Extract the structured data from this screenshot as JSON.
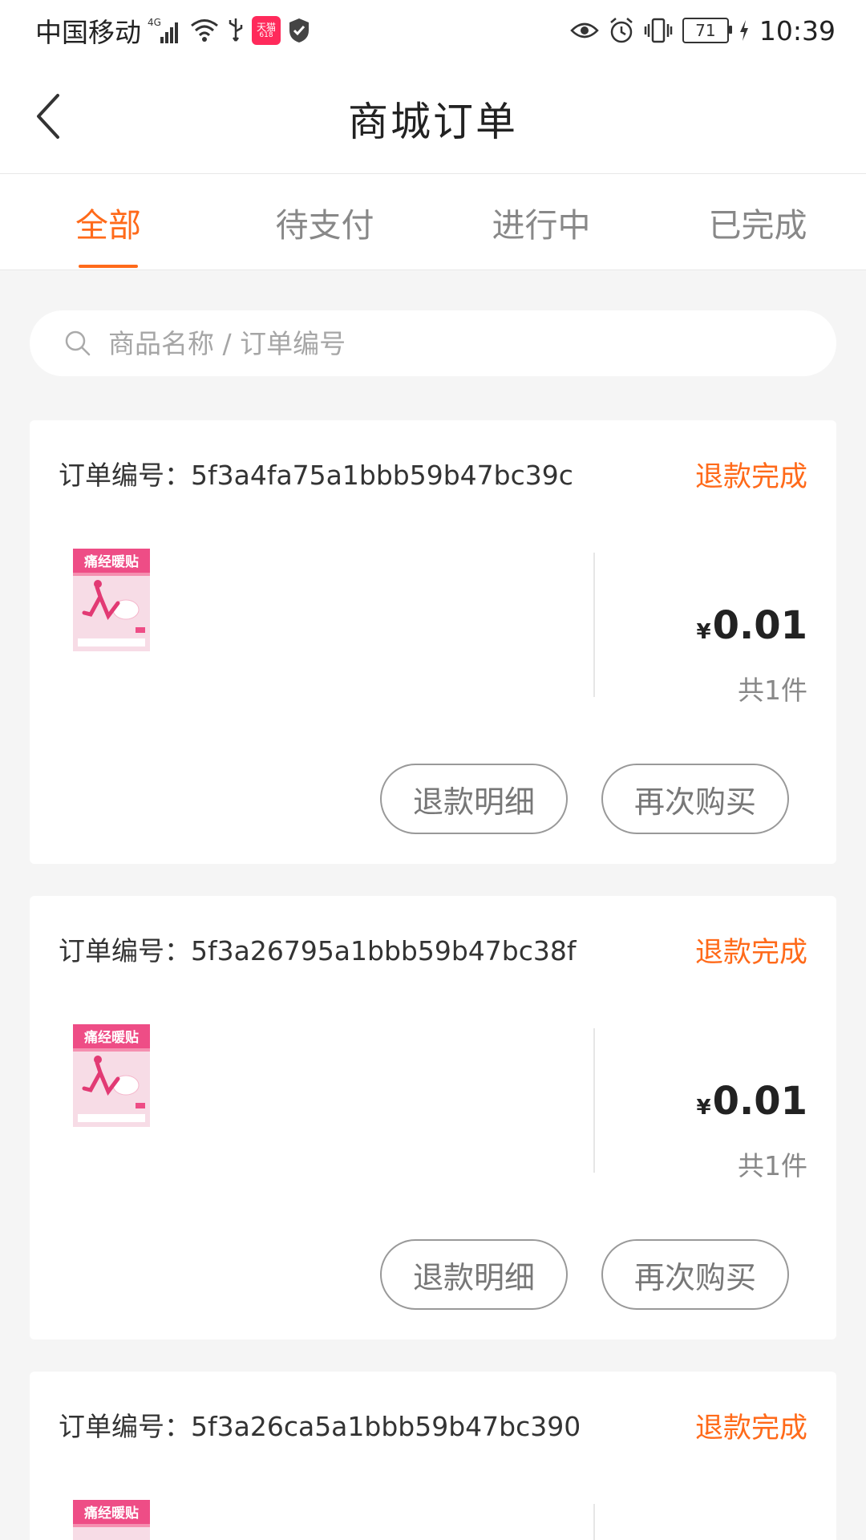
{
  "status_bar": {
    "carrier": "中国移动",
    "network": "4G",
    "tmall_badge": "天猫",
    "tmall_badge_sub": "618",
    "battery": "71",
    "time": "10:39"
  },
  "header": {
    "title": "商城订单",
    "back_icon": "chevron-left-icon"
  },
  "tabs": [
    {
      "label": "全部",
      "active": true
    },
    {
      "label": "待支付",
      "active": false
    },
    {
      "label": "进行中",
      "active": false
    },
    {
      "label": "已完成",
      "active": false
    }
  ],
  "search": {
    "placeholder": "商品名称 / 订单编号"
  },
  "orders": [
    {
      "order_no": "订单编号：5f3a4fa75a1bbb59b47bc39c",
      "status": "退款完成",
      "product_title": "痛经暖贴",
      "currency": "¥",
      "price": "0.01",
      "quantity": "共1件",
      "refund_detail_label": "退款明细",
      "rebuy_label": "再次购买"
    },
    {
      "order_no": "订单编号：5f3a26795a1bbb59b47bc38f",
      "status": "退款完成",
      "product_title": "痛经暖贴",
      "currency": "¥",
      "price": "0.01",
      "quantity": "共1件",
      "refund_detail_label": "退款明细",
      "rebuy_label": "再次购买"
    },
    {
      "order_no": "订单编号：5f3a26ca5a1bbb59b47bc390",
      "status": "退款完成",
      "product_title": "痛经暖贴"
    }
  ],
  "colors": {
    "accent": "#ff6a1a",
    "background": "#f5f5f5",
    "product_pink": "#f0568a"
  }
}
